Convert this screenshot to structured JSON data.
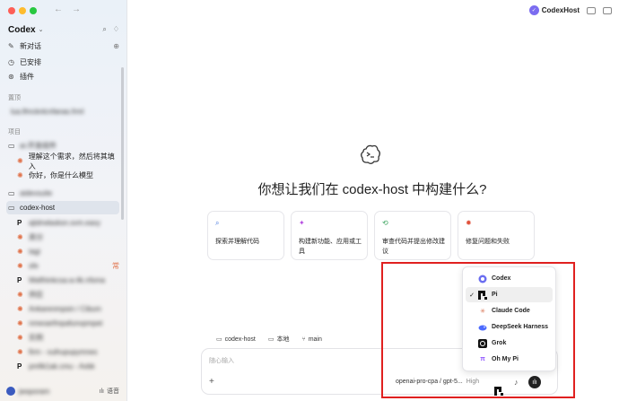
{
  "sidebar": {
    "title": "Codex",
    "nav": [
      {
        "icon": "edit-icon",
        "label": "新对话"
      },
      {
        "icon": "clock-icon",
        "label": "已安排"
      },
      {
        "icon": "plugin-icon",
        "label": "插件"
      }
    ],
    "pinned_label": "置顶",
    "pinned_item": "lua.lfmcknlcnfanas.frml",
    "projects_label": "项目",
    "projects": [
      {
        "label": "ai-开发组件",
        "chats": [
          "理解这个需求，然后将其填入",
          "你好，你是什么模型"
        ]
      },
      {
        "label": "aidevsuite",
        "chats": []
      },
      {
        "label": "codex-host",
        "chats": [
          "ajtdrwlasksn.svm.eaxy",
          "类分",
          "tagi",
          "sfe",
          "Wafihinkcsa.w.4k.nfsma",
          "供应",
          "Ankarenmpsin / Cibum",
          "nmeoarfmpafunvpmpet",
          "实例",
          "firm - xuihupupymnes",
          "pmfik1ak.cmu - Avbk"
        ]
      }
    ],
    "footer_user": "jwsporam",
    "footer_voice": "语音"
  },
  "topbar": {
    "brand": "CodexHost"
  },
  "main": {
    "heading": "你想让我们在 codex-host 中构建什么?",
    "cards": [
      {
        "icon": "search-code-icon",
        "label": "探索并理解代码"
      },
      {
        "icon": "build-icon",
        "label": "构建新功能、应用或工具"
      },
      {
        "icon": "review-icon",
        "label": "审查代码并提出修改建议"
      },
      {
        "icon": "bug-icon",
        "label": "修复问题和失败"
      }
    ]
  },
  "context_bar": {
    "project": "codex-host",
    "location": "本地",
    "branch": "main"
  },
  "composer": {
    "placeholder": "随心输入",
    "model": "openai-pro-cpa / gpt-5...",
    "reasoning": "High"
  },
  "agent_menu": {
    "selected": "Pi",
    "items": [
      {
        "label": "Codex",
        "icon": "codex-icon",
        "color": "#6a6df0"
      },
      {
        "label": "Pi",
        "icon": "pi-icon",
        "color": "#111111"
      },
      {
        "label": "Claude Code",
        "icon": "claude-icon",
        "color": "#d97757"
      },
      {
        "label": "DeepSeek Harness",
        "icon": "deepseek-icon",
        "color": "#4d6bfe"
      },
      {
        "label": "Grok",
        "icon": "grok-icon",
        "color": "#111111"
      },
      {
        "label": "Oh My Pi",
        "icon": "ohmypi-icon",
        "color": "#8a4dff"
      }
    ]
  },
  "sidebar_badge": "常"
}
